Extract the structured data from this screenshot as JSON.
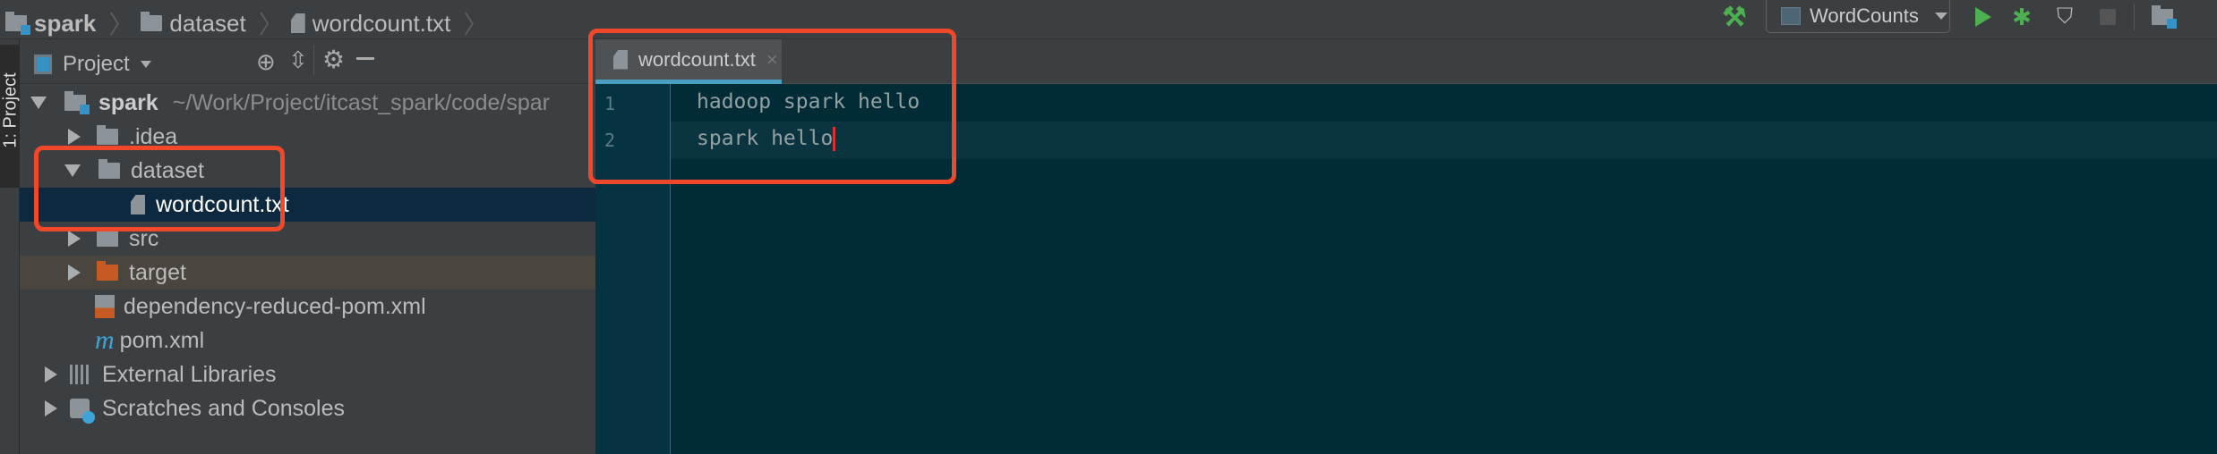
{
  "breadcrumb": {
    "items": [
      "spark",
      "dataset",
      "wordcount.txt"
    ]
  },
  "toolbar": {
    "run_config": "WordCounts",
    "icons": [
      "hammer-icon",
      "run-icon",
      "debug-icon",
      "coverage-icon",
      "stop-icon",
      "project-structure-icon"
    ]
  },
  "tool_window_stripe": {
    "project_tab": "1: Project"
  },
  "project_panel": {
    "title": "Project",
    "tree": {
      "root": {
        "name": "spark",
        "path": "~/Work/Project/itcast_spark/code/spar"
      },
      "items": [
        ".idea",
        "dataset",
        "wordcount.txt",
        "src",
        "target",
        "dependency-reduced-pom.xml",
        "pom.xml",
        "External Libraries",
        "Scratches and Consoles"
      ]
    }
  },
  "editor": {
    "tab": {
      "label": "wordcount.txt",
      "close": "×"
    },
    "lines": [
      {
        "number": "1",
        "text": "hadoop spark hello"
      },
      {
        "number": "2",
        "text": "spark hello"
      }
    ]
  },
  "colors": {
    "annotation": "#f2482a",
    "editor_bg": "#012b36",
    "selection": "#0d2940",
    "accent": "#4a9fc0"
  }
}
